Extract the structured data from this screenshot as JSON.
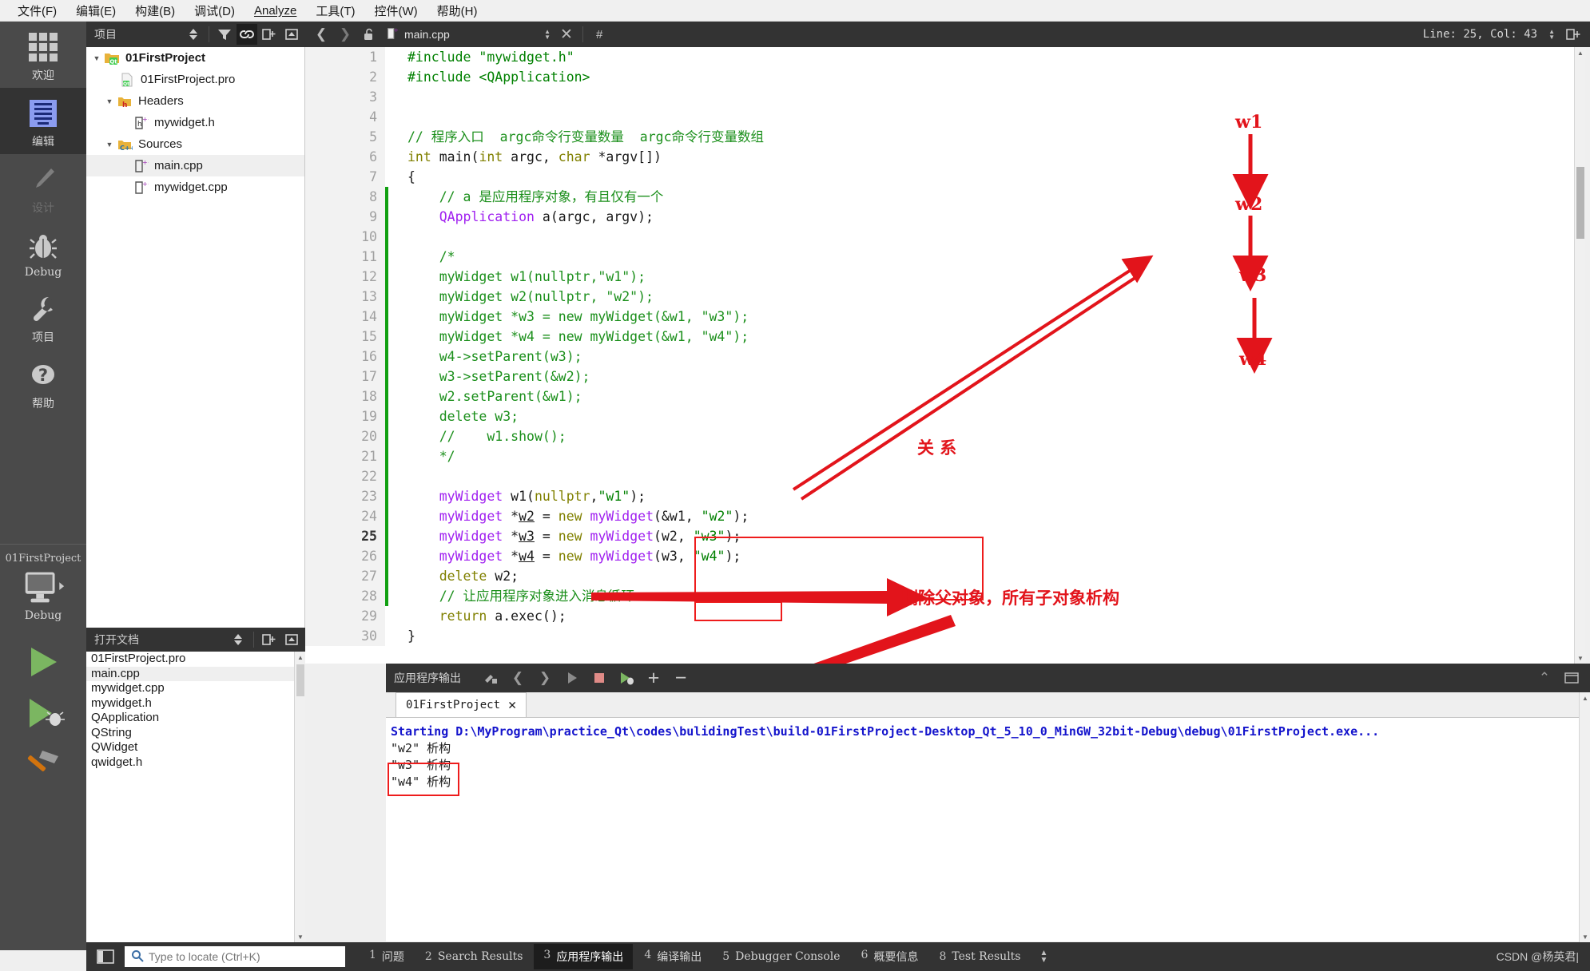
{
  "menubar": {
    "items": [
      {
        "label": "文件(F)"
      },
      {
        "label": "编辑(E)"
      },
      {
        "label": "构建(B)"
      },
      {
        "label": "调试(D)"
      },
      {
        "label": "Analyze"
      },
      {
        "label": "工具(T)"
      },
      {
        "label": "控件(W)"
      },
      {
        "label": "帮助(H)"
      }
    ]
  },
  "modebar": {
    "items": [
      {
        "label": "欢迎",
        "icon": "grid-icon",
        "state": "normal"
      },
      {
        "label": "编辑",
        "icon": "document-lines-icon",
        "state": "active"
      },
      {
        "label": "设计",
        "icon": "pencil-icon",
        "state": "disabled"
      },
      {
        "label": "Debug",
        "icon": "bug-icon",
        "state": "normal"
      },
      {
        "label": "项目",
        "icon": "wrench-icon",
        "state": "normal"
      },
      {
        "label": "帮助",
        "icon": "question-circle-icon",
        "state": "normal"
      }
    ],
    "kit": {
      "project_name": "01FirstProject",
      "build_config": "Debug",
      "desktop_icon": "desktop-monitor-icon",
      "run_button": "run-play-icon",
      "debug_button": "run-debug-icon",
      "build_button": "hammer-build-icon"
    }
  },
  "project_panel": {
    "title": "项目",
    "toolbar_icons": [
      "sort-stepper-icon",
      "filter-icon",
      "link-sync-icon",
      "split-add-icon",
      "collapse-icon"
    ],
    "tree": [
      {
        "label": "01FirstProject",
        "icon": "qt-folder-icon",
        "indent": 0,
        "expanded": true,
        "bold": true,
        "selected": false
      },
      {
        "label": "01FirstProject.pro",
        "icon": "qt-pro-file-icon",
        "indent": 1,
        "expanded": null,
        "bold": false,
        "selected": false
      },
      {
        "label": "Headers",
        "icon": "h-folder-icon",
        "indent": 1,
        "expanded": true,
        "bold": false,
        "selected": false
      },
      {
        "label": "mywidget.h",
        "icon": "h-file-icon",
        "indent": 2,
        "expanded": null,
        "bold": false,
        "selected": false
      },
      {
        "label": "Sources",
        "icon": "cpp-folder-icon",
        "indent": 1,
        "expanded": true,
        "bold": false,
        "selected": false
      },
      {
        "label": "main.cpp",
        "icon": "cpp-file-icon",
        "indent": 2,
        "expanded": null,
        "bold": false,
        "selected": true
      },
      {
        "label": "mywidget.cpp",
        "icon": "cpp-file-icon",
        "indent": 2,
        "expanded": null,
        "bold": false,
        "selected": false
      }
    ]
  },
  "open_documents": {
    "title": "打开文档",
    "items": [
      {
        "label": "01FirstProject.pro",
        "selected": false
      },
      {
        "label": "main.cpp",
        "selected": true
      },
      {
        "label": "mywidget.cpp",
        "selected": false
      },
      {
        "label": "mywidget.h",
        "selected": false
      },
      {
        "label": "QApplication",
        "selected": false
      },
      {
        "label": "QString",
        "selected": false
      },
      {
        "label": "QWidget",
        "selected": false
      },
      {
        "label": "qwidget.h",
        "selected": false
      }
    ]
  },
  "editor_toolbar": {
    "back_icon": "chevron-left-icon",
    "forward_icon": "chevron-right-icon",
    "lock_icon": "unlock-icon",
    "file_icon": "cpp-file-icon",
    "filename": "main.cpp",
    "symbol_placeholder": "#",
    "line_col": "Line: 25, Col: 43",
    "split_icon": "split-editor-icon"
  },
  "code": {
    "lines": [
      {
        "n": 1,
        "fold": false,
        "cur": false
      },
      {
        "n": 2,
        "fold": false,
        "cur": false
      },
      {
        "n": 3,
        "fold": false,
        "cur": false
      },
      {
        "n": 4,
        "fold": false,
        "cur": false
      },
      {
        "n": 5,
        "fold": false,
        "cur": false
      },
      {
        "n": 6,
        "fold": true,
        "cur": false
      },
      {
        "n": 7,
        "fold": false,
        "cur": false
      },
      {
        "n": 8,
        "fold": false,
        "cur": false
      },
      {
        "n": 9,
        "fold": false,
        "cur": false
      },
      {
        "n": 10,
        "fold": false,
        "cur": false
      },
      {
        "n": 11,
        "fold": true,
        "cur": false
      },
      {
        "n": 12,
        "fold": false,
        "cur": false
      },
      {
        "n": 13,
        "fold": false,
        "cur": false
      },
      {
        "n": 14,
        "fold": false,
        "cur": false
      },
      {
        "n": 15,
        "fold": false,
        "cur": false
      },
      {
        "n": 16,
        "fold": false,
        "cur": false
      },
      {
        "n": 17,
        "fold": false,
        "cur": false
      },
      {
        "n": 18,
        "fold": false,
        "cur": false
      },
      {
        "n": 19,
        "fold": false,
        "cur": false
      },
      {
        "n": 20,
        "fold": false,
        "cur": false
      },
      {
        "n": 21,
        "fold": false,
        "cur": false
      },
      {
        "n": 22,
        "fold": false,
        "cur": false
      },
      {
        "n": 23,
        "fold": false,
        "cur": false
      },
      {
        "n": 24,
        "fold": false,
        "cur": false
      },
      {
        "n": 25,
        "fold": false,
        "cur": true
      },
      {
        "n": 26,
        "fold": false,
        "cur": false
      },
      {
        "n": 27,
        "fold": false,
        "cur": false
      },
      {
        "n": 28,
        "fold": false,
        "cur": false
      },
      {
        "n": 29,
        "fold": false,
        "cur": false
      },
      {
        "n": 30,
        "fold": false,
        "cur": false
      }
    ],
    "text": [
      "#include \"mywidget.h\"",
      "#include <QApplication>",
      "",
      "",
      "// 程序入口  argc命令行变量数量  argc命令行变量数组",
      "int main(int argc, char *argv[])",
      "{",
      "    // a 是应用程序对象，有且仅有一个",
      "    QApplication a(argc, argv);",
      "",
      "    /*",
      "    myWidget w1(nullptr,\"w1\");",
      "    myWidget w2(nullptr, \"w2\");",
      "    myWidget *w3 = new myWidget(&w1, \"w3\");",
      "    myWidget *w4 = new myWidget(&w1, \"w4\");",
      "    w4->setParent(w3);",
      "    w3->setParent(&w2);",
      "    w2.setParent(&w1);",
      "    delete w3;",
      "    //    w1.show();",
      "    */",
      "",
      "    myWidget w1(nullptr,\"w1\");",
      "    myWidget *w2 = new myWidget(&w1, \"w2\");",
      "    myWidget *w3 = new myWidget(w2, \"w3\");",
      "    myWidget *w4 = new myWidget(w3, \"w4\");",
      "    delete w2;",
      "    // 让应用程序对象进入消息循环",
      "    return a.exec();",
      "}"
    ]
  },
  "annotations": {
    "w_labels": [
      "w1",
      "w2",
      "w3",
      "w4"
    ],
    "relation_label": "关 系",
    "delete_note": "删除父对象，所有子对象析构"
  },
  "output_panel": {
    "title": "应用程序输出",
    "toolbar_icons": [
      "clear-icon",
      "prev-icon",
      "next-icon",
      "play-icon",
      "stop-icon",
      "rerun-debug-icon",
      "zoom-in-icon",
      "zoom-out-icon"
    ],
    "collapse_icon": "chevron-up-icon",
    "maximize_icon": "maximize-pane-icon",
    "tab": {
      "label": "01FirstProject",
      "close_icon": "close-x-icon"
    },
    "lines": [
      {
        "text": "Starting D:\\MyProgram\\practice_Qt\\codes\\bulidingTest\\build-01FirstProject-Desktop_Qt_5_10_0_MinGW_32bit-Debug\\debug\\01FirstProject.exe...",
        "style": "blue"
      },
      {
        "text": "\"w2\" 析构",
        "style": "normal"
      },
      {
        "text": "\"w3\" 析构",
        "style": "normal"
      },
      {
        "text": "\"w4\" 析构",
        "style": "normal"
      }
    ]
  },
  "statusbar": {
    "sidebar_toggle_icon": "sidebar-toggle-icon",
    "locator": {
      "icon": "search-icon",
      "placeholder": "Type to locate (Ctrl+K)"
    },
    "tabs": [
      {
        "num": "1",
        "label": "问题",
        "active": false
      },
      {
        "num": "2",
        "label": "Search Results",
        "active": false
      },
      {
        "num": "3",
        "label": "应用程序输出",
        "active": true
      },
      {
        "num": "4",
        "label": "编译输出",
        "active": false
      },
      {
        "num": "5",
        "label": "Debugger Console",
        "active": false
      },
      {
        "num": "6",
        "label": "概要信息",
        "active": false
      },
      {
        "num": "8",
        "label": "Test Results",
        "active": false
      }
    ],
    "stepper_icon": "updown-stepper-icon",
    "watermark": "CSDN @杨英君|"
  },
  "colors": {
    "accent_red": "#e2141b",
    "dark_chrome": "#333333",
    "modebar": "#4a4a4a",
    "comment_green": "#1b8f1b",
    "type_purple": "#a020f0",
    "keyword_olive": "#808000"
  }
}
